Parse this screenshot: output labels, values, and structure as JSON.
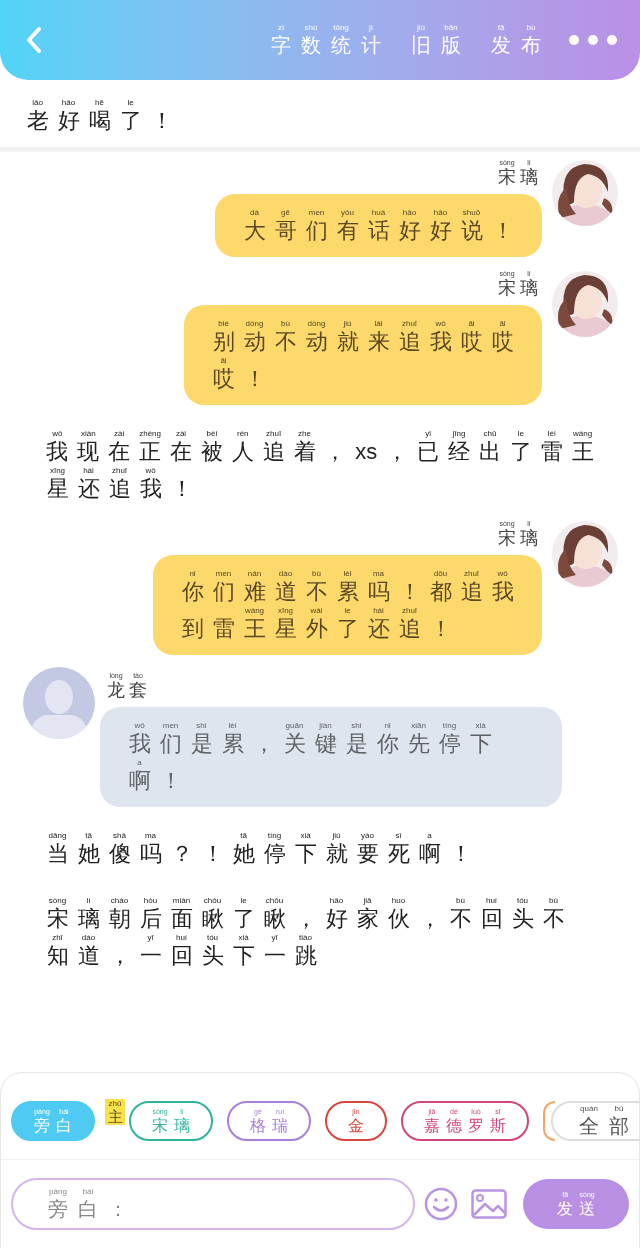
{
  "header": {
    "actions": [
      {
        "lines": [
          [
            {
              "py": "zì",
              "ch": "字"
            },
            {
              "py": "shù",
              "ch": "数"
            },
            {
              "py": "tǒng",
              "ch": "统"
            },
            {
              "py": "jì",
              "ch": "计"
            }
          ]
        ]
      },
      {
        "lines": [
          [
            {
              "py": "jiù",
              "ch": "旧"
            },
            {
              "py": "bǎn",
              "ch": "版"
            }
          ]
        ]
      },
      {
        "lines": [
          [
            {
              "py": "fā",
              "ch": "发"
            },
            {
              "py": "bù",
              "ch": "布"
            }
          ]
        ]
      }
    ]
  },
  "top_message": {
    "lines": [
      [
        {
          "py": "lǎo",
          "ch": "老"
        },
        {
          "py": "hǎo",
          "ch": "好"
        },
        {
          "py": "hē",
          "ch": "喝"
        },
        {
          "py": "le",
          "ch": "了"
        },
        {
          "ch": "！"
        }
      ]
    ]
  },
  "messages": [
    {
      "kind": "outgoing",
      "speaker": [
        [
          {
            "py": "sòng",
            "ch": "宋"
          },
          {
            "py": "lí",
            "ch": "璃"
          }
        ]
      ],
      "lines": [
        [
          {
            "py": "dà",
            "ch": "大"
          },
          {
            "py": "gē",
            "ch": "哥"
          },
          {
            "py": "men",
            "ch": "们"
          },
          {
            "py": "yǒu",
            "ch": "有"
          },
          {
            "py": "huà",
            "ch": "话"
          },
          {
            "py": "hǎo",
            "ch": "好"
          },
          {
            "py": "hǎo",
            "ch": "好"
          },
          {
            "py": "shuō",
            "ch": "说"
          },
          {
            "ch": "！"
          }
        ]
      ]
    },
    {
      "kind": "outgoing",
      "speaker": [
        [
          {
            "py": "sòng",
            "ch": "宋"
          },
          {
            "py": "lí",
            "ch": "璃"
          }
        ]
      ],
      "lines": [
        [
          {
            "py": "bié",
            "ch": "别"
          },
          {
            "py": "dòng",
            "ch": "动"
          },
          {
            "py": "bù",
            "ch": "不"
          },
          {
            "py": "dòng",
            "ch": "动"
          },
          {
            "py": "jiù",
            "ch": "就"
          },
          {
            "py": "lái",
            "ch": "来"
          },
          {
            "py": "zhuī",
            "ch": "追"
          },
          {
            "py": "wǒ",
            "ch": "我"
          },
          {
            "py": "āi",
            "ch": "哎"
          },
          {
            "py": "āi",
            "ch": "哎"
          }
        ],
        [
          {
            "py": "āi",
            "ch": "哎"
          },
          {
            "ch": "！"
          }
        ]
      ]
    },
    {
      "kind": "narration",
      "lines": [
        [
          {
            "py": "wǒ",
            "ch": "我"
          },
          {
            "py": "xiàn",
            "ch": "现"
          },
          {
            "py": "zài",
            "ch": "在"
          },
          {
            "py": "zhèng",
            "ch": "正"
          },
          {
            "py": "zài",
            "ch": "在"
          },
          {
            "py": "bèi",
            "ch": "被"
          },
          {
            "py": "rén",
            "ch": "人"
          },
          {
            "py": "zhuī",
            "ch": "追"
          },
          {
            "py": "zhe",
            "ch": "着"
          },
          {
            "ch": "，"
          },
          {
            "ch": "xs"
          },
          {
            "ch": "，"
          },
          {
            "py": "yǐ",
            "ch": "已"
          },
          {
            "py": "jīng",
            "ch": "经"
          },
          {
            "py": "chū",
            "ch": "出"
          },
          {
            "py": "le",
            "ch": "了"
          },
          {
            "py": "léi",
            "ch": "雷"
          },
          {
            "py": "wáng",
            "ch": "王"
          }
        ],
        [
          {
            "py": "xīng",
            "ch": "星"
          },
          {
            "py": "hái",
            "ch": "还"
          },
          {
            "py": "zhuī",
            "ch": "追"
          },
          {
            "py": "wǒ",
            "ch": "我"
          },
          {
            "ch": "！"
          }
        ]
      ]
    },
    {
      "kind": "outgoing",
      "speaker": [
        [
          {
            "py": "sòng",
            "ch": "宋"
          },
          {
            "py": "lí",
            "ch": "璃"
          }
        ]
      ],
      "lines": [
        [
          {
            "py": "nǐ",
            "ch": "你"
          },
          {
            "py": "men",
            "ch": "们"
          },
          {
            "py": "nán",
            "ch": "难"
          },
          {
            "py": "dào",
            "ch": "道"
          },
          {
            "py": "bù",
            "ch": "不"
          },
          {
            "py": "lèi",
            "ch": "累"
          },
          {
            "py": "ma",
            "ch": "吗"
          },
          {
            "ch": "！"
          },
          {
            "py": "dōu",
            "ch": "都"
          },
          {
            "py": "zhuī",
            "ch": "追"
          },
          {
            "py": "wǒ",
            "ch": "我"
          }
        ],
        [
          {
            "ch": "到"
          },
          {
            "ch": "雷"
          },
          {
            "py": "wáng",
            "ch": "王"
          },
          {
            "py": "xīng",
            "ch": "星"
          },
          {
            "py": "wài",
            "ch": "外"
          },
          {
            "py": "le",
            "ch": "了"
          },
          {
            "py": "hái",
            "ch": "还"
          },
          {
            "py": "zhuī",
            "ch": "追"
          },
          {
            "ch": "！"
          }
        ]
      ]
    },
    {
      "kind": "incoming",
      "speaker": [
        [
          {
            "py": "lóng",
            "ch": "龙"
          },
          {
            "py": "tào",
            "ch": "套"
          }
        ]
      ],
      "lines": [
        [
          {
            "py": "wǒ",
            "ch": "我"
          },
          {
            "py": "men",
            "ch": "们"
          },
          {
            "py": "shì",
            "ch": "是"
          },
          {
            "py": "lèi",
            "ch": "累"
          },
          {
            "ch": "，"
          },
          {
            "py": "guān",
            "ch": "关"
          },
          {
            "py": "jiàn",
            "ch": "键"
          },
          {
            "py": "shì",
            "ch": "是"
          },
          {
            "py": "nǐ",
            "ch": "你"
          },
          {
            "py": "xiān",
            "ch": "先"
          },
          {
            "py": "tíng",
            "ch": "停"
          },
          {
            "py": "xià",
            "ch": "下"
          }
        ],
        [
          {
            "py": "a",
            "ch": "啊"
          },
          {
            "ch": "！"
          }
        ]
      ]
    },
    {
      "kind": "narration",
      "lines": [
        [
          {
            "py": "dāng",
            "ch": "当"
          },
          {
            "py": "tā",
            "ch": "她"
          },
          {
            "py": "shǎ",
            "ch": "傻"
          },
          {
            "py": "ma",
            "ch": "吗"
          },
          {
            "ch": "？"
          },
          {
            "ch": "！"
          },
          {
            "py": "tā",
            "ch": "她"
          },
          {
            "py": "tíng",
            "ch": "停"
          },
          {
            "py": "xià",
            "ch": "下"
          },
          {
            "py": "jiù",
            "ch": "就"
          },
          {
            "py": "yào",
            "ch": "要"
          },
          {
            "py": "sǐ",
            "ch": "死"
          },
          {
            "py": "a",
            "ch": "啊"
          },
          {
            "ch": "！"
          }
        ]
      ]
    },
    {
      "kind": "narration",
      "lines": [
        [
          {
            "py": "sòng",
            "ch": "宋"
          },
          {
            "py": "lí",
            "ch": "璃"
          },
          {
            "py": "cháo",
            "ch": "朝"
          },
          {
            "py": "hòu",
            "ch": "后"
          },
          {
            "py": "miàn",
            "ch": "面"
          },
          {
            "py": "chǒu",
            "ch": "瞅"
          },
          {
            "py": "le",
            "ch": "了"
          },
          {
            "py": "chǒu",
            "ch": "瞅"
          },
          {
            "ch": "，"
          },
          {
            "py": "hǎo",
            "ch": "好"
          },
          {
            "py": "jiā",
            "ch": "家"
          },
          {
            "py": "huo",
            "ch": "伙"
          },
          {
            "ch": "，"
          },
          {
            "py": "bù",
            "ch": "不"
          },
          {
            "py": "huí",
            "ch": "回"
          },
          {
            "py": "tóu",
            "ch": "头"
          },
          {
            "py": "bù",
            "ch": "不"
          }
        ],
        [
          {
            "py": "zhī",
            "ch": "知"
          },
          {
            "py": "dào",
            "ch": "道"
          },
          {
            "ch": "，"
          },
          {
            "py": "yī",
            "ch": "一"
          },
          {
            "py": "huí",
            "ch": "回"
          },
          {
            "py": "tóu",
            "ch": "头"
          },
          {
            "py": "xià",
            "ch": "下"
          },
          {
            "py": "yī",
            "ch": "一"
          },
          {
            "py": "tiào",
            "ch": "跳"
          }
        ]
      ]
    }
  ],
  "roles": [
    {
      "lines": [
        [
          {
            "py": "páng",
            "ch": "旁"
          },
          {
            "py": "bái",
            "ch": "白"
          }
        ]
      ],
      "color": "#4fcaf2",
      "selected": true
    },
    {
      "badge": [
        [
          {
            "py": "zhǔ",
            "ch": "主"
          }
        ]
      ],
      "lines": [
        [
          {
            "py": "sòng",
            "ch": "宋"
          },
          {
            "py": "lí",
            "ch": "璃"
          }
        ]
      ],
      "color": "#2fb3a0",
      "selected": false
    },
    {
      "lines": [
        [
          {
            "py": "gé",
            "ch": "格"
          },
          {
            "py": "ruì",
            "ch": "瑞"
          }
        ]
      ],
      "color": "#a97fd9",
      "selected": false
    },
    {
      "lines": [
        [
          {
            "py": "jīn",
            "ch": "金"
          }
        ]
      ],
      "color": "#d8453d",
      "selected": false
    },
    {
      "lines": [
        [
          {
            "py": "jiā",
            "ch": "嘉"
          },
          {
            "py": "dé",
            "ch": "德"
          },
          {
            "py": "luó",
            "ch": "罗"
          },
          {
            "py": "sī",
            "ch": "斯"
          }
        ]
      ],
      "color": "#d4447f",
      "selected": false
    },
    {
      "color": "#f0a868",
      "selected": false
    }
  ],
  "all_roles": {
    "lines": [
      [
        {
          "py": "quán",
          "ch": "全"
        },
        {
          "py": "bù",
          "ch": "部"
        }
      ]
    ]
  },
  "composer": {
    "placeholder": [
      [
        {
          "py": "páng",
          "ch": "旁"
        },
        {
          "py": "bái",
          "ch": "白"
        },
        {
          "ch": "："
        }
      ]
    ],
    "send": {
      "lines": [
        [
          {
            "py": "fā",
            "ch": "发"
          },
          {
            "py": "sòng",
            "ch": "送"
          }
        ]
      ]
    }
  }
}
